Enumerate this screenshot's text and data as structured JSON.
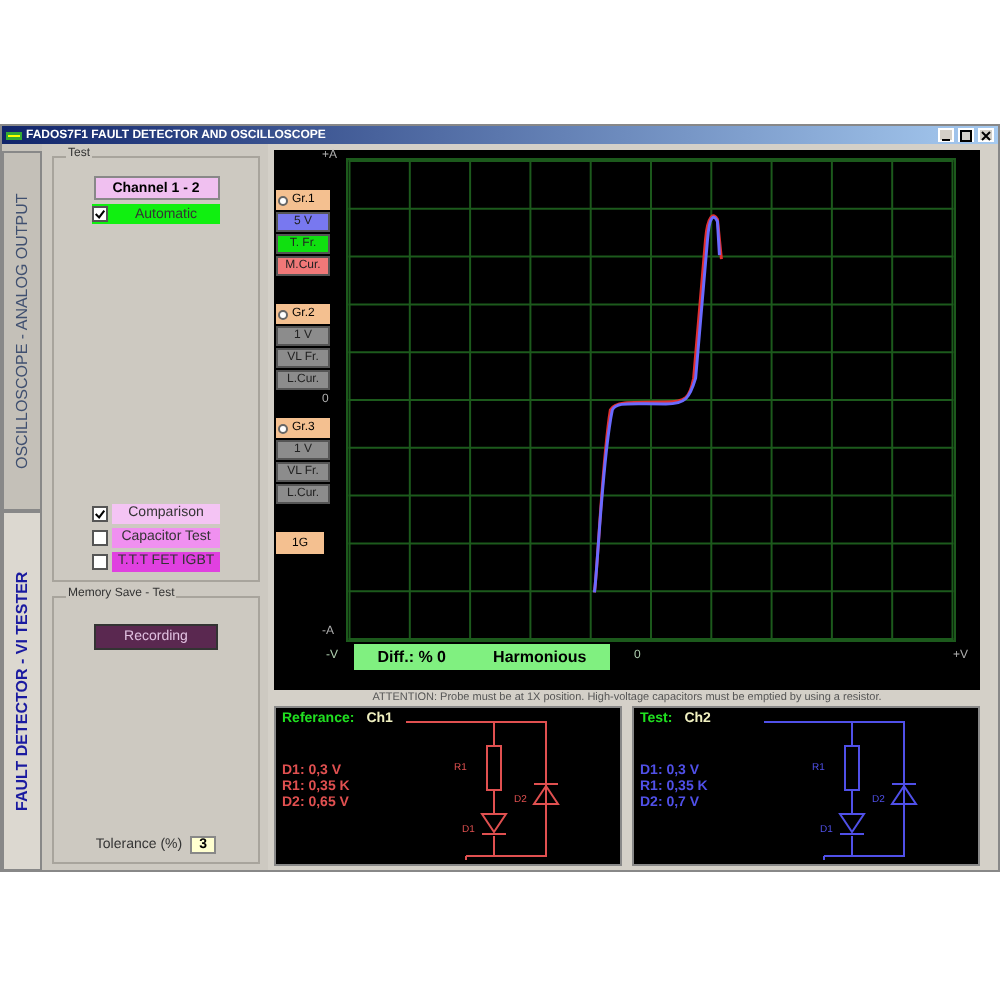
{
  "window": {
    "title": "FADOS7F1  FAULT DETECTOR AND OSCILLOSCOPE"
  },
  "tabs": [
    {
      "label": "OSCILLOSCOPE - ANALOG OUTPUT",
      "selected": false
    },
    {
      "label": "FAULT DETECTOR - VI TESTER",
      "selected": true
    }
  ],
  "test_group": {
    "title": "Test",
    "channel_button": "Channel 1 - 2",
    "automatic": {
      "label": "Automatic",
      "checked": true
    },
    "options": [
      {
        "label": "Comparison",
        "checked": true,
        "color": "#f4c4f4"
      },
      {
        "label": "Capacitor Test",
        "checked": false,
        "color": "#f090f0"
      },
      {
        "label": "T.T.T  FET  IGBT",
        "checked": false,
        "color": "#e040e0"
      }
    ]
  },
  "memory_group": {
    "title": "Memory Save - Test",
    "record_button": "Recording",
    "tolerance": {
      "label": "Tolerance (%)",
      "value": "3"
    }
  },
  "scope": {
    "groups": [
      {
        "label": "Gr.1",
        "selected": false,
        "buttons": [
          {
            "label": "5 V",
            "color": "#7878f0"
          },
          {
            "label": "T. Fr.",
            "color": "#10e010"
          },
          {
            "label": "M.Cur.",
            "color": "#f07878"
          }
        ]
      },
      {
        "label": "Gr.2",
        "selected": false,
        "buttons": [
          {
            "label": "1 V",
            "color": "#8c8c8c"
          },
          {
            "label": "VL Fr.",
            "color": "#8c8c8c"
          },
          {
            "label": "L.Cur.",
            "color": "#8c8c8c"
          }
        ]
      },
      {
        "label": "Gr.3",
        "selected": false,
        "buttons": [
          {
            "label": "1 V",
            "color": "#8c8c8c"
          },
          {
            "label": "VL Fr.",
            "color": "#8c8c8c"
          },
          {
            "label": "L.Cur.",
            "color": "#8c8c8c"
          }
        ]
      }
    ],
    "gain_button": "1G",
    "y_labels": [
      "+A",
      "0",
      "-A"
    ],
    "x_labels": [
      "-V",
      "0",
      "+V"
    ],
    "diff": "Diff.:  % 0",
    "verdict": "Harmonious"
  },
  "attention": "ATTENTION: Probe must be at 1X position. High-voltage capacitors must be emptied by using a resistor.",
  "circuits": [
    {
      "title": "Referance:",
      "channel": "Ch1",
      "color": "#e05050",
      "readings": [
        "D1: 0,3 V",
        "R1: 0,35 K",
        "D2: 0,65 V"
      ],
      "r_label": "R1",
      "d1_label": "D1",
      "d2_label": "D2"
    },
    {
      "title": "Test:",
      "channel": "Ch2",
      "color": "#5050e8",
      "readings": [
        "D1: 0,3 V",
        "R1: 0,35 K",
        "D2: 0,7 V"
      ],
      "r_label": "R1",
      "d1_label": "D1",
      "d2_label": "D2"
    }
  ]
}
